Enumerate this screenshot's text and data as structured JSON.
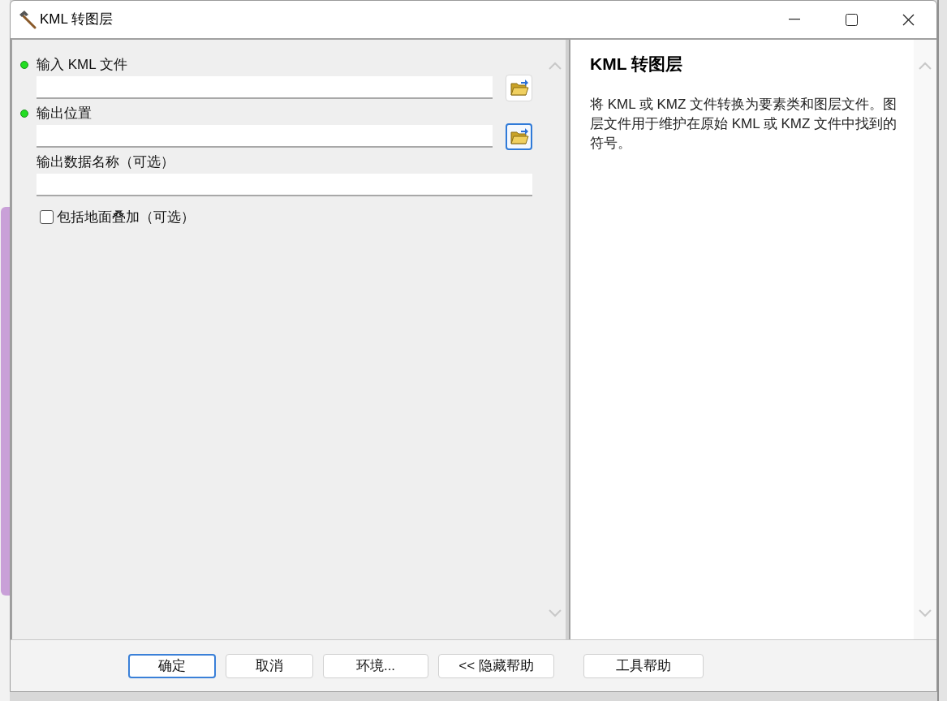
{
  "window": {
    "title": "KML 转图层"
  },
  "parameters": [
    {
      "kind": "field",
      "label": "输入 KML 文件",
      "required": true,
      "browse": true,
      "browse_focused": false
    },
    {
      "kind": "field",
      "label": "输出位置",
      "required": true,
      "browse": true,
      "browse_focused": true
    },
    {
      "kind": "field",
      "label": "输出数据名称（可选）",
      "required": false,
      "browse": false
    },
    {
      "kind": "checkbox",
      "label": "包括地面叠加（可选）",
      "checked": false
    }
  ],
  "help": {
    "title": "KML 转图层",
    "text": "将 KML 或 KMZ 文件转换为要素类和图层文件。图层文件用于维护在原始 KML 或 KMZ 文件中找到的符号。"
  },
  "buttons": [
    {
      "label": "确定",
      "focused": true
    },
    {
      "label": "取消",
      "focused": false
    },
    {
      "label": "环境...",
      "focused": false
    },
    {
      "label": "<< 隐藏帮助",
      "focused": false
    },
    {
      "label": "工具帮助",
      "focused": false
    }
  ]
}
